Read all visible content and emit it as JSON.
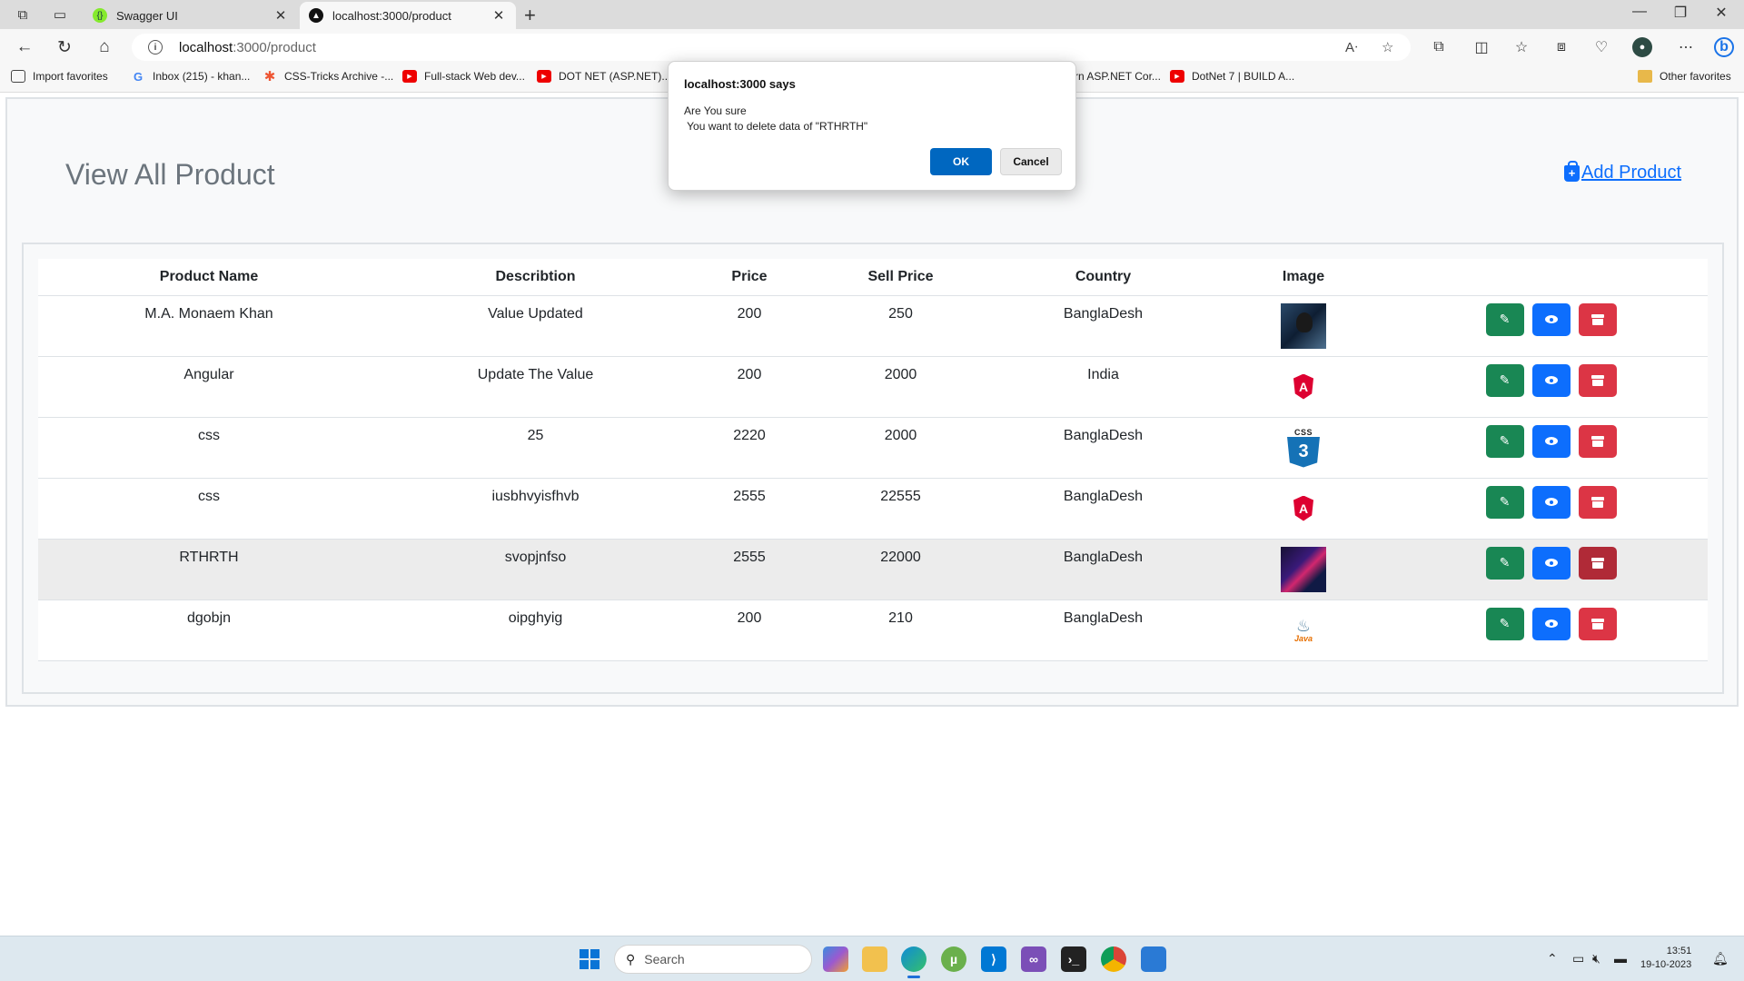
{
  "browser": {
    "tabs": [
      {
        "title": "Swagger UI",
        "active": false,
        "favicon": "swagger-icon"
      },
      {
        "title": "localhost:3000/product",
        "active": true,
        "favicon": "nextjs-icon"
      }
    ],
    "address": {
      "host": "localhost",
      "path": ":3000/product"
    },
    "bookmarks": [
      {
        "label": "Import favorites",
        "icon": "import-icon"
      },
      {
        "label": "Inbox (215) - khan...",
        "icon": "google-icon"
      },
      {
        "label": "CSS-Tricks Archive -...",
        "icon": "css-tricks-icon"
      },
      {
        "label": "Full-stack Web dev...",
        "icon": "youtube-icon"
      },
      {
        "label": "DOT NET (ASP.NET)...",
        "icon": "youtube-icon"
      },
      {
        "label": "rn ASP.NET Cor...",
        "icon": "youtube-icon"
      },
      {
        "label": "DotNet 7 | BUILD A...",
        "icon": "youtube-icon"
      },
      {
        "label": "Other favorites",
        "icon": "folder-icon"
      }
    ]
  },
  "page": {
    "title": "View All Product",
    "add_product_label": "Add Product",
    "table": {
      "headers": [
        "Product Name",
        "Describtion",
        "Price",
        "Sell Price",
        "Country",
        "Image",
        ""
      ],
      "rows": [
        {
          "name": "M.A. Monaem Khan",
          "description": "Value Updated",
          "price": "200",
          "sell_price": "250",
          "country": "BanglaDesh",
          "image": "person-photo"
        },
        {
          "name": "Angular",
          "description": "Update The Value",
          "price": "200",
          "sell_price": "2000",
          "country": "India",
          "image": "angular-logo"
        },
        {
          "name": "css",
          "description": "25",
          "price": "2220",
          "sell_price": "2000",
          "country": "BanglaDesh",
          "image": "css3-logo"
        },
        {
          "name": "css",
          "description": "iusbhvyisfhvb",
          "price": "2555",
          "sell_price": "22555",
          "country": "BanglaDesh",
          "image": "angular-logo"
        },
        {
          "name": "RTHRTH",
          "description": "svopjnfso",
          "price": "2555",
          "sell_price": "22000",
          "country": "BanglaDesh",
          "image": "abstract-image"
        },
        {
          "name": "dgobjn",
          "description": "oipghyig",
          "price": "200",
          "sell_price": "210",
          "country": "BanglaDesh",
          "image": "java-logo"
        }
      ],
      "highlighted_row": 4
    }
  },
  "dialog": {
    "title": "localhost:3000 says",
    "line1": "Are You sure",
    "line2": " You want to delete data of \"RTHRTH\"",
    "ok_label": "OK",
    "cancel_label": "Cancel"
  },
  "taskbar": {
    "search_placeholder": "Search",
    "time": "13:51",
    "date": "19-10-2023"
  },
  "logo_text": {
    "angular": "A",
    "css3_label": "CSS",
    "css3_mark": "3",
    "java": "Java"
  },
  "colors": {
    "edit": "#198754",
    "view": "#0d6efd",
    "delete": "#dc3545",
    "link": "#0d6efd"
  }
}
